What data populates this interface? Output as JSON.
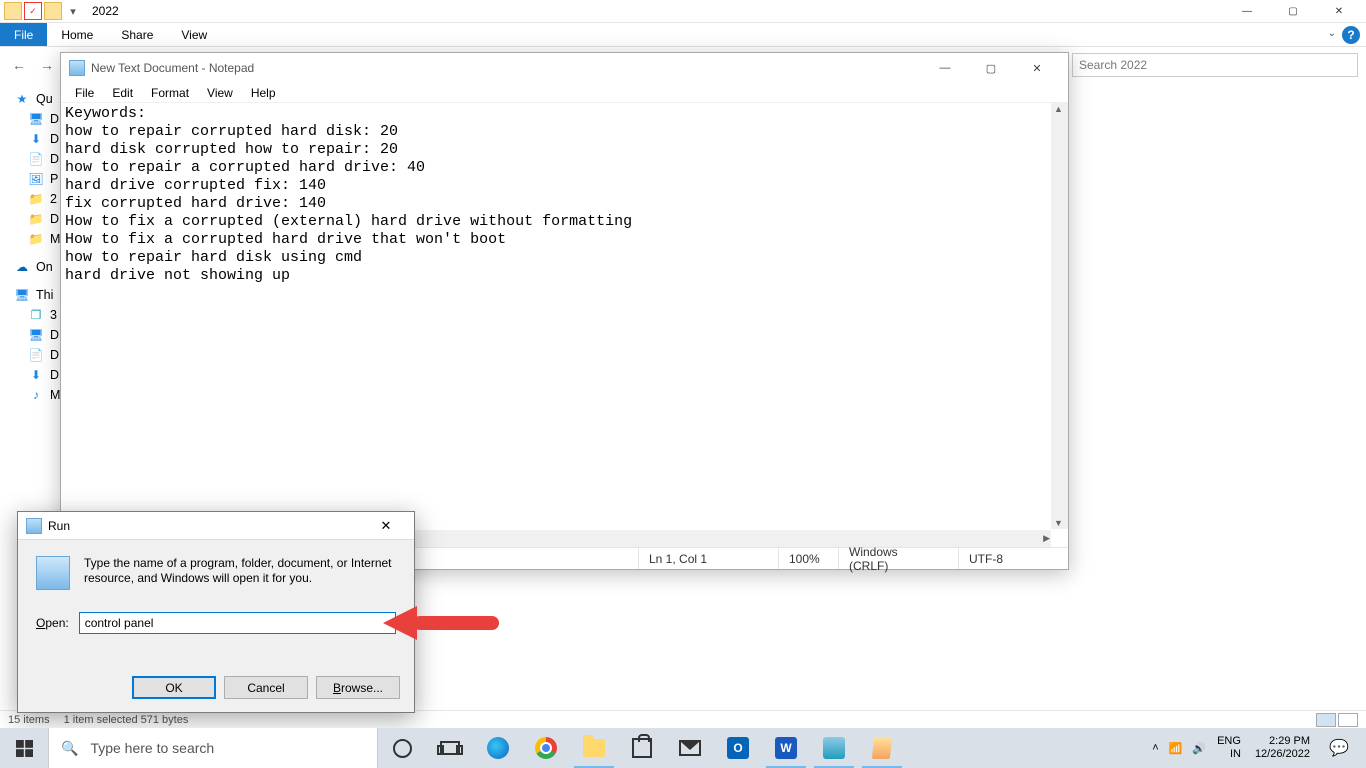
{
  "explorer": {
    "title": "2022",
    "ribbon": {
      "file": "File",
      "home": "Home",
      "share": "Share",
      "view": "View"
    },
    "search_placeholder": "Search 2022",
    "side": {
      "quick": "Qu",
      "items_a": [
        "D",
        "D",
        "D",
        "P",
        "2",
        "D",
        "M"
      ],
      "onedrive": "On",
      "thispc": "Thi",
      "items_b": [
        "3",
        "D",
        "D",
        "D",
        "M"
      ]
    },
    "status": {
      "items": "15 items",
      "selected": "1 item selected  571 bytes"
    }
  },
  "notepad": {
    "title": "New Text Document - Notepad",
    "menu": {
      "file": "File",
      "edit": "Edit",
      "format": "Format",
      "view": "View",
      "help": "Help"
    },
    "content": "Keywords:\nhow to repair corrupted hard disk: 20\nhard disk corrupted how to repair: 20\nhow to repair a corrupted hard drive: 40\nhard drive corrupted fix: 140\nfix corrupted hard drive: 140\nHow to fix a corrupted (external) hard drive without formatting\nHow to fix a corrupted hard drive that won't boot\nhow to repair hard disk using cmd\nhard drive not showing up",
    "status": {
      "pos": "Ln 1, Col 1",
      "zoom": "100%",
      "eol": "Windows (CRLF)",
      "enc": "UTF-8"
    }
  },
  "run": {
    "title": "Run",
    "message": "Type the name of a program, folder, document, or Internet resource, and Windows will open it for you.",
    "open_label": "Open:",
    "open_value": "control panel",
    "ok": "OK",
    "cancel": "Cancel",
    "browse": "Browse..."
  },
  "taskbar": {
    "search_placeholder": "Type here to search",
    "lang1": "ENG",
    "lang2": "IN",
    "time": "2:29 PM",
    "date": "12/26/2022"
  }
}
